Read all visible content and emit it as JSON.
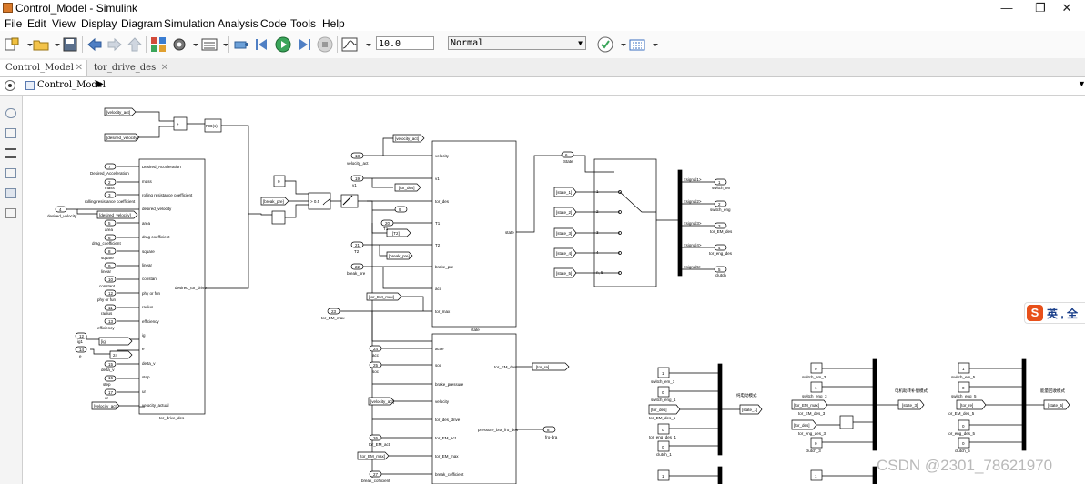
{
  "window": {
    "title": "Control_Model - Simulink",
    "minimize": "—",
    "restore": "❐",
    "close": "✕"
  },
  "menu": [
    "File",
    "Edit",
    "View",
    "Display",
    "Diagram",
    "Simulation",
    "Analysis",
    "Code",
    "Tools",
    "Help"
  ],
  "toolbar": {
    "stop_time": "10.0",
    "sim_mode": "Normal"
  },
  "tabs": [
    {
      "label": "Control_Model"
    },
    {
      "label": "tor_drive_des"
    }
  ],
  "address": {
    "path": "Control_Model"
  },
  "sogou": {
    "label": "英 , 全"
  },
  "watermark": "CSDN @2301_78621970",
  "canvas": {
    "top_left": {
      "vel_act": "[velocity_act]",
      "vel_des": "[desired_velocity]",
      "pid": "PID(s)"
    },
    "subsys1": {
      "name": "tor_drive_des",
      "inputs": [
        "Desired_Acceleration",
        "mass",
        "rolling resistance coefficient",
        "desired_velocity",
        "area",
        "drag coefficient",
        "square",
        "linear",
        "constant",
        "phy or fun",
        "radius",
        "efficiency",
        "ig",
        "e",
        "delta_v",
        "step",
        "ur",
        "velocity_actual"
      ],
      "output": "desired_tor_drive",
      "ext_labels": [
        "Desired_Acceleration",
        "mass",
        "rolling resistance coefficient",
        "desired_velocity",
        "area",
        "drag_coefficient",
        "square",
        "linear",
        "constant",
        "phy or fun",
        "radius",
        "efficiency",
        "ig1",
        "e",
        "delta_v",
        "step",
        "ur"
      ],
      "port_nums": [
        "7",
        "2",
        "3",
        "4",
        "5",
        "6",
        "8",
        "9",
        "10",
        "12",
        "11",
        "13",
        "12",
        "14",
        "15",
        "16",
        "17"
      ],
      "goto_ig": "[ig]",
      "from_desvel": "[desired_velocity]",
      "from_velact": "[velocity_act]",
      "desvel_label": "desired_velocity",
      "num24": "24"
    },
    "mid_small": {
      "const": "0",
      "break_pre": "[break_pre]",
      "switch": "> 0.5"
    },
    "subsys2": {
      "name": "state",
      "inputs": [
        "velocity",
        "v1",
        "tor_des",
        "T1",
        "T2",
        "brake_pre",
        "acc",
        "tor_max"
      ],
      "output": "state",
      "ext_labels": [
        "velocity_act",
        "v1",
        "T1",
        "T2",
        "break_pre",
        "tor_EM_max"
      ],
      "ext_nums": [
        "18",
        "19",
        "20",
        "21",
        "22",
        "23"
      ],
      "goto_velact": "[velocity_act]",
      "goto_tordes": "[tor_des]",
      "goto_T2": "[T2]",
      "goto_break": "[break_pre]",
      "from_emmax": "[tor_EM_max]",
      "num9": "9"
    },
    "subsys3": {
      "inputs": [
        "acce",
        "soc",
        "brake_pressure",
        "velocity",
        "tor_des_drive",
        "tor_EM_act",
        "tor_EM_max",
        "break_cofficient"
      ],
      "outputs": [
        "tor_EM_des",
        "pressure_bra_fro_des"
      ],
      "goto_torre": "[tor_re]",
      "out_num": "8",
      "out_label": "fro-bra",
      "ext": [
        "acc",
        "soc",
        "[velocity_act]",
        "tor_EM_act",
        "[tor_EM_max]",
        "break_cofficient"
      ],
      "ext_nums": [
        "24",
        "25",
        "26",
        "27"
      ]
    },
    "state_switch": {
      "out_num": "6",
      "out_label": "State",
      "froms": [
        "[state_1]",
        "[state_2]",
        "[state_3]",
        "[state_4]",
        "[state_5]"
      ],
      "ports": [
        "1",
        "2",
        "3",
        "4",
        "n, 5"
      ]
    },
    "bus": {
      "signals": [
        "<signal1>",
        "<signal2>",
        "<signal3>",
        "<signal4>",
        "<signal5>"
      ],
      "outs": [
        "switch_IM",
        "switch_eng",
        "tor_EM_des",
        "tor_eng_des",
        "clutch"
      ],
      "nums": [
        "1",
        "2",
        "3",
        "4",
        "5"
      ]
    },
    "mode1": {
      "inputs": [
        "switch_em_1",
        "switch_eng_1",
        "tor_EM_des_1",
        "tor_eng_des_1",
        "clutch_1"
      ],
      "vals": [
        "1",
        "0",
        "[tor_des]",
        "0",
        "0"
      ],
      "note": "纯电动模式",
      "goto": "[state_1]"
    },
    "mode2": {
      "inputs": [
        "switch_em_3",
        "switch_eng_3",
        "tor_EM_des_3",
        "tor_eng_des_3",
        "clutch_3"
      ],
      "vals": [
        "0",
        "1",
        "[tor_EM_max]",
        "[tor_des]",
        "0"
      ],
      "note": "电机助转补偿模式",
      "goto": "[state_3]"
    },
    "mode3": {
      "inputs": [
        "switch_em_5",
        "switch_eng_5",
        "tor_EM_des_5",
        "tor_eng_des_5",
        "clutch_5"
      ],
      "vals": [
        "1",
        "0",
        "[tor_re]",
        "0",
        "0"
      ],
      "note": "能量回收模式",
      "goto": "[state_5]"
    },
    "bottom_consts": [
      "1",
      "1"
    ]
  }
}
